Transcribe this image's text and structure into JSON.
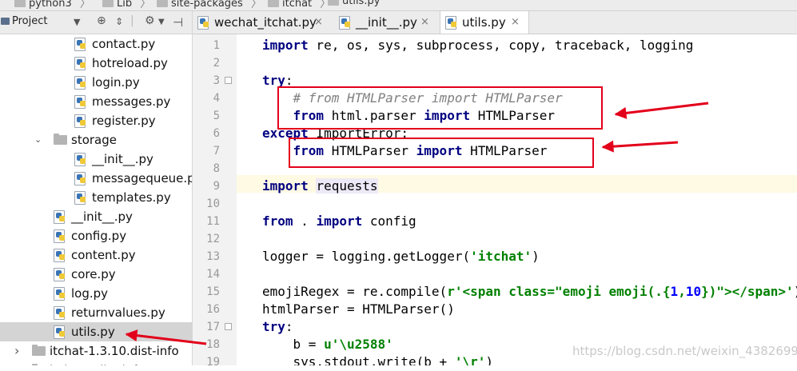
{
  "breadcrumb": [
    "python3",
    "Lib",
    "site-packages",
    "itchat",
    "utils.py"
  ],
  "project_panel": {
    "title": "Project",
    "tree": [
      {
        "label": "contact.py",
        "type": "py"
      },
      {
        "label": "hotreload.py",
        "type": "py"
      },
      {
        "label": "login.py",
        "type": "py"
      },
      {
        "label": "messages.py",
        "type": "py"
      },
      {
        "label": "register.py",
        "type": "py"
      },
      {
        "label": "storage",
        "type": "dir",
        "expanded": true
      },
      {
        "label": "__init__.py",
        "type": "py"
      },
      {
        "label": "messagequeue.py",
        "type": "py"
      },
      {
        "label": "templates.py",
        "type": "py"
      },
      {
        "label": "__init__.py",
        "type": "py"
      },
      {
        "label": "config.py",
        "type": "py"
      },
      {
        "label": "content.py",
        "type": "py"
      },
      {
        "label": "core.py",
        "type": "py"
      },
      {
        "label": "log.py",
        "type": "py"
      },
      {
        "label": "returnvalues.py",
        "type": "py"
      },
      {
        "label": "utils.py",
        "type": "py",
        "selected": true
      },
      {
        "label": "itchat-1.3.10.dist-info",
        "type": "dir",
        "expanded": false
      },
      {
        "label": "itchat-..dist-info",
        "type": "dir",
        "expanded": false
      }
    ]
  },
  "tabs": [
    {
      "label": "wechat_itchat.py",
      "active": false
    },
    {
      "label": "__init__.py",
      "active": false
    },
    {
      "label": "utils.py",
      "active": true
    }
  ],
  "code": {
    "lines": [
      {
        "n": "1",
        "html": "<span class='kw'>import</span> re, os, sys, subprocess, copy, traceback, logging"
      },
      {
        "n": "2",
        "html": ""
      },
      {
        "n": "3",
        "html": "<span class='kw'>try</span>:"
      },
      {
        "n": "4",
        "html": "    <span class='cm'># from HTMLParser import HTMLParser</span>"
      },
      {
        "n": "5",
        "html": "    <span class='kw'>from</span> html.parser <span class='kw'>import</span> HTMLParser"
      },
      {
        "n": "6",
        "html": "<span class='kw'>except</span> ImportError:"
      },
      {
        "n": "7",
        "html": "    <span class='kw'>from</span> HTMLParser <span class='kw'>import</span> HTMLParser"
      },
      {
        "n": "8",
        "html": ""
      },
      {
        "n": "9",
        "html": "<span class='kw'>import</span> <span class='hl-word'>requests</span>"
      },
      {
        "n": "10",
        "html": ""
      },
      {
        "n": "11",
        "html": "<span class='kw'>from</span> . <span class='kw'>import</span> config"
      },
      {
        "n": "12",
        "html": ""
      },
      {
        "n": "13",
        "html": "logger = logging.getLogger(<span class='st'>'itchat'</span>)"
      },
      {
        "n": "14",
        "html": ""
      },
      {
        "n": "15",
        "html": "emojiRegex = re.compile(<span class='st'>r'&lt;span class=\"emoji emoji(.{<span class='nm'>1</span>,<span class='nm'>10</span>})\"&gt;&lt;/span&gt;'</span>)"
      },
      {
        "n": "16",
        "html": "htmlParser = HTMLParser()"
      },
      {
        "n": "17",
        "html": "<span class='kw'>try</span>:"
      },
      {
        "n": "18",
        "html": "    b = <span class='st'>u'\\u2588'</span>"
      },
      {
        "n": "19",
        "html": "    sys.stdout.write(b + <span class='st'>'\\r'</span>)"
      }
    ]
  },
  "watermark": "https://blog.csdn.net/weixin_43826993",
  "colors": {
    "keyword": "#000080",
    "string": "#008000",
    "comment": "#808080",
    "annotation": "#e3001b"
  }
}
